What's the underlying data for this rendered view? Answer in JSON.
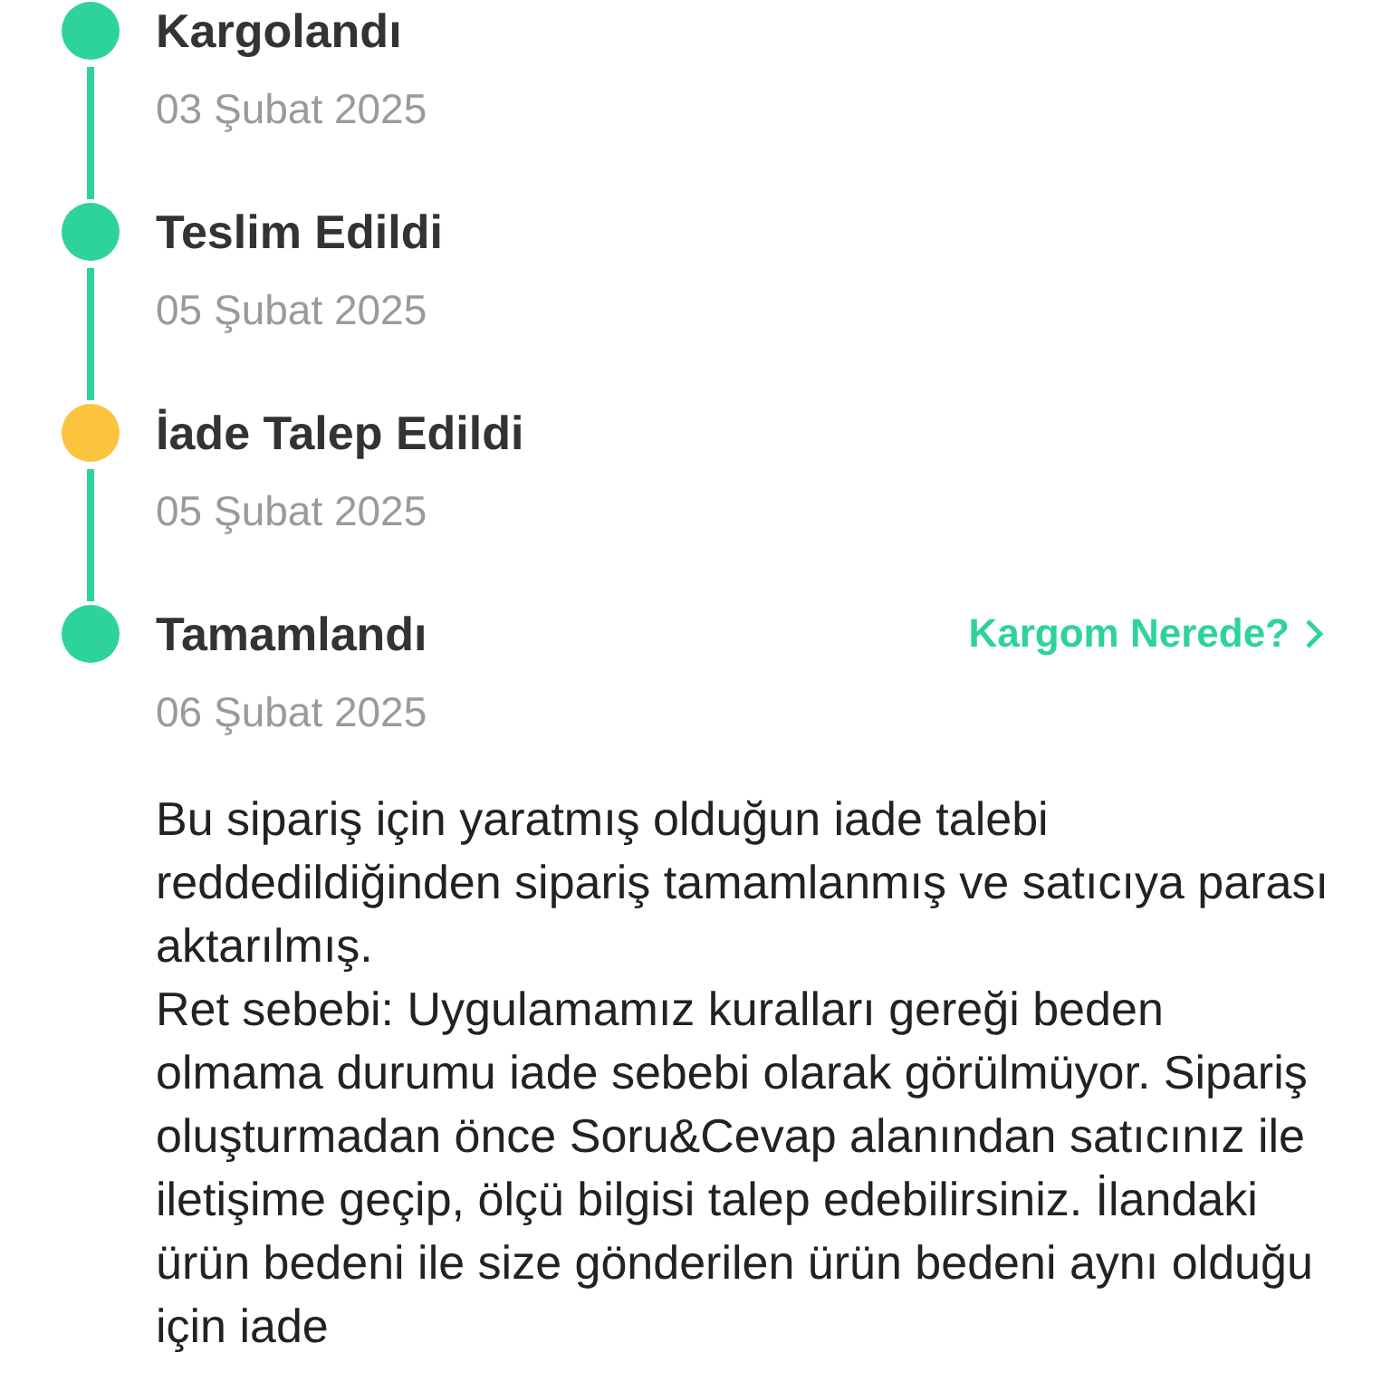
{
  "steps": [
    {
      "title": "Kargolandı",
      "date": "03 Şubat 2025",
      "color": "#2ed39a"
    },
    {
      "title": "Teslim Edildi",
      "date": "05 Şubat 2025",
      "color": "#2ed39a"
    },
    {
      "title": "İade Talep Edildi",
      "date": "05 Şubat 2025",
      "color": "#fcc43d"
    },
    {
      "title": "Tamamlandı",
      "date": "06 Şubat 2025",
      "color": "#2ed39a",
      "link": "Kargom Nerede?"
    }
  ],
  "message": [
    "Bu sipariş için yaratmış olduğun iade talebi reddedildiğinden sipariş tamamlanmış ve satıcıya parası aktarılmış.",
    "Ret sebebi: Uygulamamız kuralları gereği beden olmama durumu iade sebebi olarak görülmüyor. Sipariş oluşturmadan önce Soru&Cevap alanından satıcınız ile iletişime geçip, ölçü bilgisi talep edebilirsiniz. İlandaki ürün bedeni ile size gönderilen ürün bedeni aynı olduğu için iade"
  ]
}
